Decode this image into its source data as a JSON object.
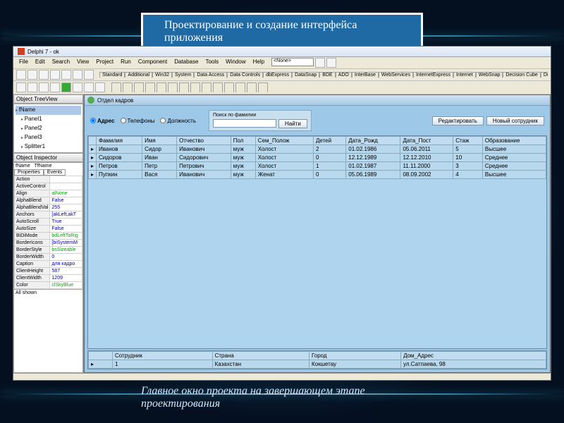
{
  "slide": {
    "title": "Проектирование и создание интерфейса приложения",
    "caption": "Главное окно проекта на завершающем этапе проектирования"
  },
  "ide": {
    "title": "Delphi 7 - ok",
    "menu": [
      "File",
      "Edit",
      "Search",
      "View",
      "Project",
      "Run",
      "Component",
      "Database",
      "Tools",
      "Window",
      "Help"
    ],
    "combo": "<None>",
    "palette_tabs": [
      "Standard",
      "Additional",
      "Win32",
      "System",
      "Data Access",
      "Data Controls",
      "dbExpress",
      "DataSnap",
      "BDE",
      "ADO",
      "InterBase",
      "WebServices",
      "InternetExpress",
      "Internet",
      "WebSnap",
      "Decision Cube",
      "Dialogs"
    ]
  },
  "tree": {
    "title": "Object TreeView",
    "root": "fName",
    "items": [
      "Panel1",
      "Panel2",
      "Panel3",
      "Splitter1"
    ]
  },
  "inspector": {
    "title": "Object Inspector",
    "obj": "fName",
    "cls": "TfName",
    "tabs": [
      "Properties",
      "Events"
    ],
    "rows": [
      [
        "Action",
        ""
      ],
      [
        "ActiveControl",
        ""
      ],
      [
        "Align",
        "alNone"
      ],
      [
        "AlphaBlend",
        "False"
      ],
      [
        "AlphaBlendVal",
        "255"
      ],
      [
        "Anchors",
        "[akLeft,akT"
      ],
      [
        "AutoScroll",
        "True"
      ],
      [
        "AutoSize",
        "False"
      ],
      [
        "BiDiMode",
        "bdLeftToRig"
      ],
      [
        "BorderIcons",
        "[biSystemM"
      ],
      [
        "BorderStyle",
        "bsSizeable"
      ],
      [
        "BorderWidth",
        "0"
      ],
      [
        "Caption",
        "для кадро"
      ],
      [
        "ClientHeight",
        "587"
      ],
      [
        "ClientWidth",
        "1209"
      ],
      [
        "Color",
        "clSkyBlue"
      ]
    ],
    "footer": "All shown"
  },
  "form": {
    "title": "Отдел кадров",
    "radios": [
      "Адрес",
      "Телефоны",
      "Должность"
    ],
    "search_label": "Поиск по фамилии",
    "find_btn": "Найти",
    "edit_btn": "Редактировать",
    "new_btn": "Новый сотрудник",
    "grid_headers": [
      "Фамилия",
      "Имя",
      "Отчество",
      "Пол",
      "Сем_Полож",
      "Детей",
      "Дата_Рожд",
      "Дата_Пост",
      "Стаж",
      "Образование"
    ],
    "grid_rows": [
      [
        "Иванов",
        "Сидор",
        "Иванович",
        "муж",
        "Холост",
        "2",
        "01.02.1986",
        "05.06.2011",
        "5",
        "Высшее"
      ],
      [
        "Сидоров",
        "Иван",
        "Сидорович",
        "муж",
        "Холост",
        "0",
        "12.12.1989",
        "12.12.2010",
        "10",
        "Среднее"
      ],
      [
        "Петров",
        "Петр",
        "Петрович",
        "муж",
        "Холост",
        "1",
        "01.02.1987",
        "11.11.2000",
        "3",
        "Среднее"
      ],
      [
        "Пупкин",
        "Вася",
        "Иванович",
        "муж",
        "Женат",
        "0",
        "05.06.1989",
        "08.09.2002",
        "4",
        "Высшее"
      ]
    ],
    "grid2_headers": [
      "Сотрудник",
      "Страна",
      "Город",
      "Дом_Адрес"
    ],
    "grid2_row": [
      "1",
      "Казахстан",
      "Кокшетау",
      "ул.Сатпаева, 98"
    ]
  }
}
